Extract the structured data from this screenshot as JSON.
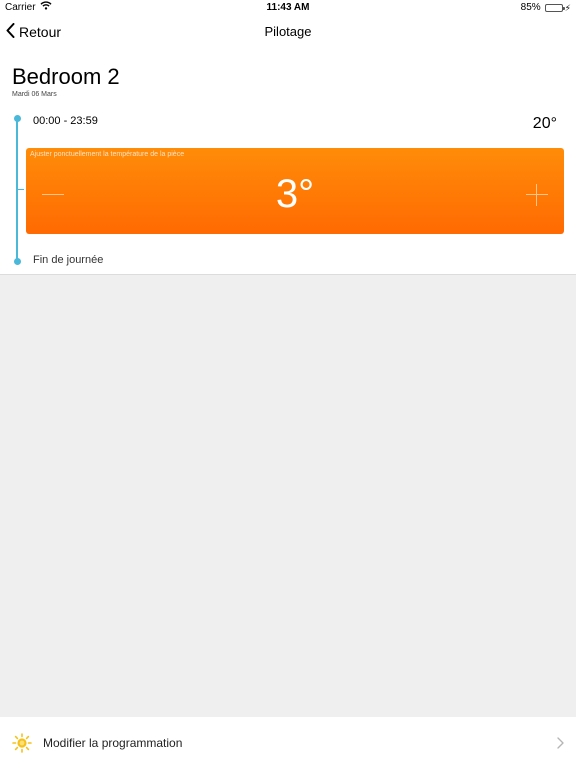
{
  "status_bar": {
    "carrier": "Carrier",
    "time": "11:43 AM",
    "battery": "85%",
    "battery_level": 0.85,
    "icons": [
      "wifi-icon",
      "battery-icon",
      "charging-bolt-icon"
    ]
  },
  "nav": {
    "back_label": "Retour",
    "title": "Pilotage",
    "icons": [
      "chevron-left-icon"
    ]
  },
  "room": {
    "name": "Bedroom 2",
    "date": "Mardi 06 Mars"
  },
  "schedule": {
    "slot_time": "00:00 - 23:59",
    "slot_temperature": "20°",
    "end_label": "Fin de journée"
  },
  "adjust": {
    "hint": "Ajuster ponctuellement la température de la pièce",
    "value": "3°",
    "icons": [
      "minus-icon",
      "plus-icon"
    ]
  },
  "footer": {
    "label": "Modifier la programmation",
    "icons": [
      "sun-icon",
      "chevron-right-icon"
    ]
  },
  "colors": {
    "accent_orange": "#ff7a05",
    "timeline_blue": "#4ab8d8",
    "background_gray": "#efefef",
    "sun_yellow": "#f5c21b",
    "battery_green": "#4cd964"
  }
}
